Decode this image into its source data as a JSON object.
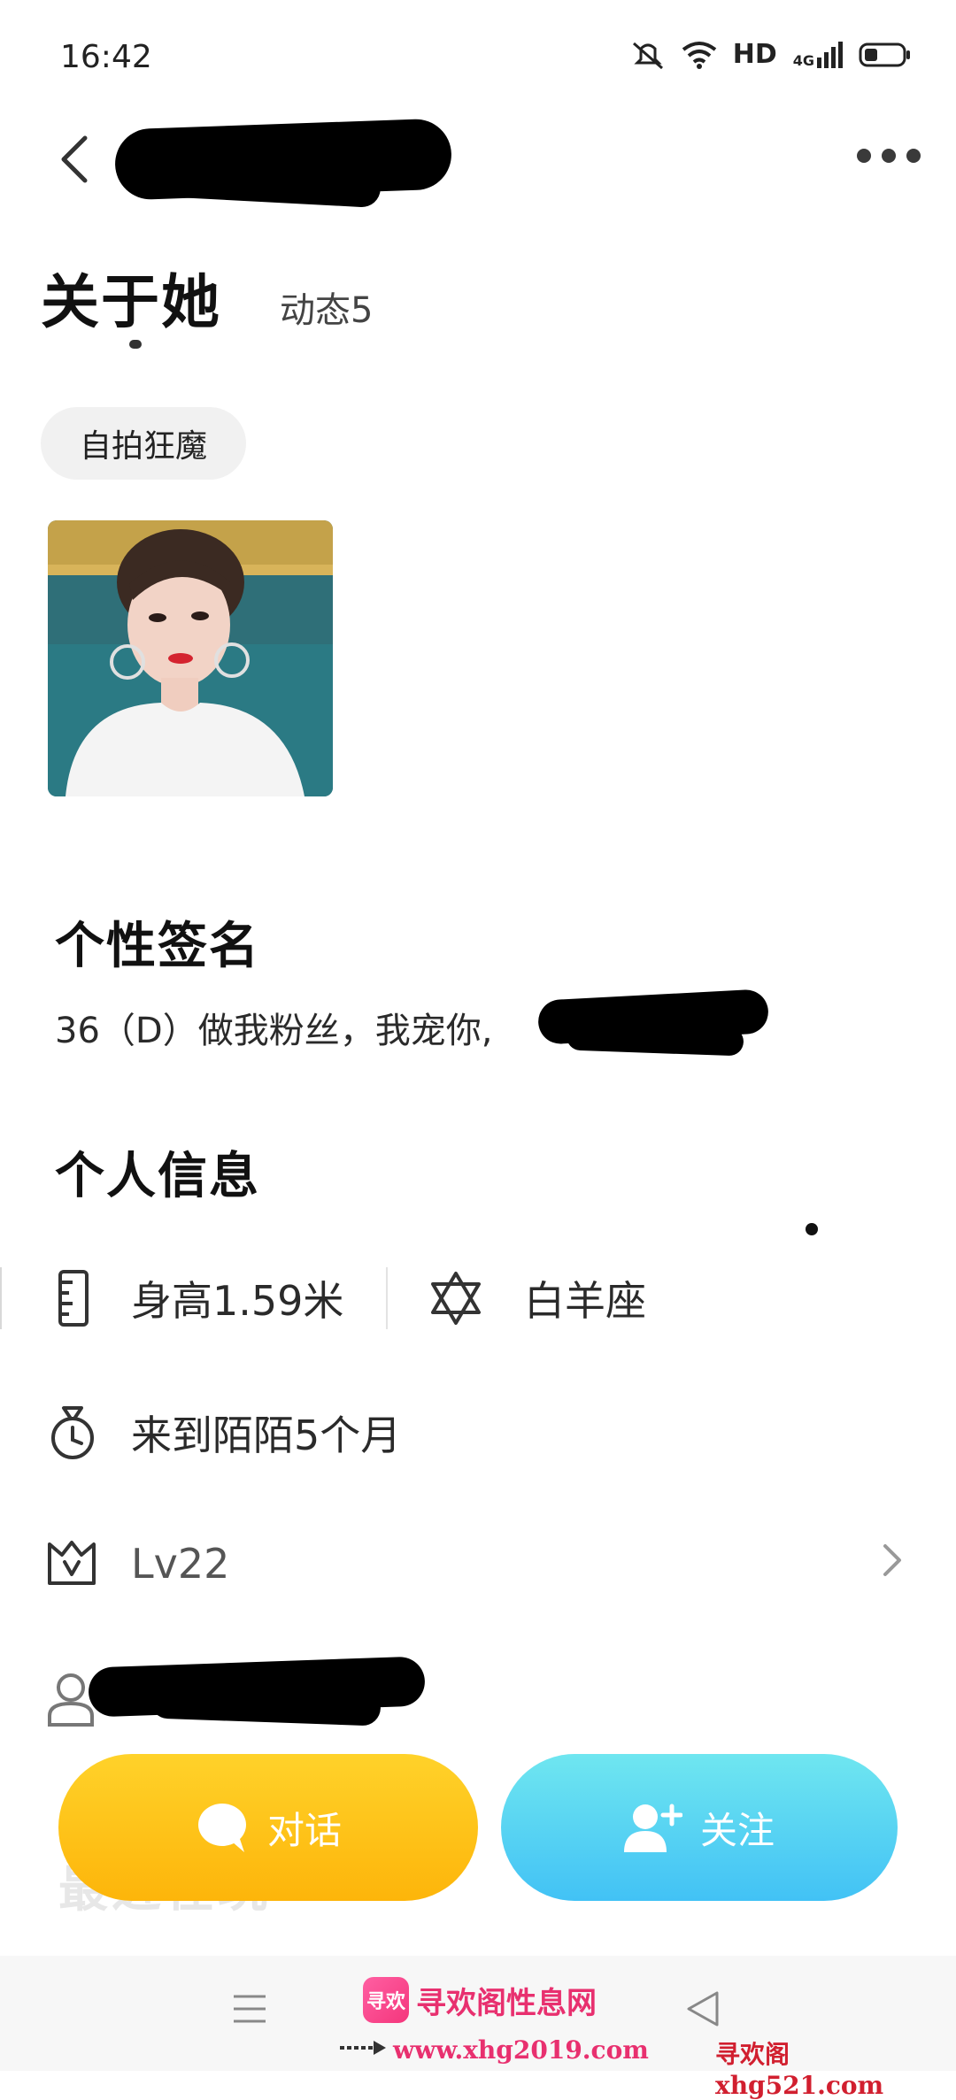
{
  "status_bar": {
    "time": "16:42",
    "hd": "HD",
    "network": "4G"
  },
  "tabs": {
    "about": "关于她",
    "feed": "动态5"
  },
  "tag": "自拍狂魔",
  "signature": {
    "title": "个性签名",
    "text": "36（D）做我粉丝，我宠你,"
  },
  "info": {
    "title": "个人信息",
    "height": "身高1.59米",
    "zodiac": "白羊座",
    "joined": "来到陌陌5个月",
    "level": "Lv22"
  },
  "ghost_section": "最近在玩",
  "buttons": {
    "chat": "对话",
    "follow": "关注"
  },
  "watermark": {
    "logo": "寻欢",
    "title": "寻欢阁性息网",
    "url": "www.xhg2019.com",
    "right": "寻欢阁xhg521.com"
  },
  "icons": [
    "back-icon",
    "more-icon",
    "ruler-icon",
    "star-of-david-icon",
    "stopwatch-icon",
    "crown-icon",
    "chevron-right-icon",
    "person-icon",
    "chat-bubble-icon",
    "add-user-icon",
    "menu-icon",
    "nav-back-icon"
  ]
}
